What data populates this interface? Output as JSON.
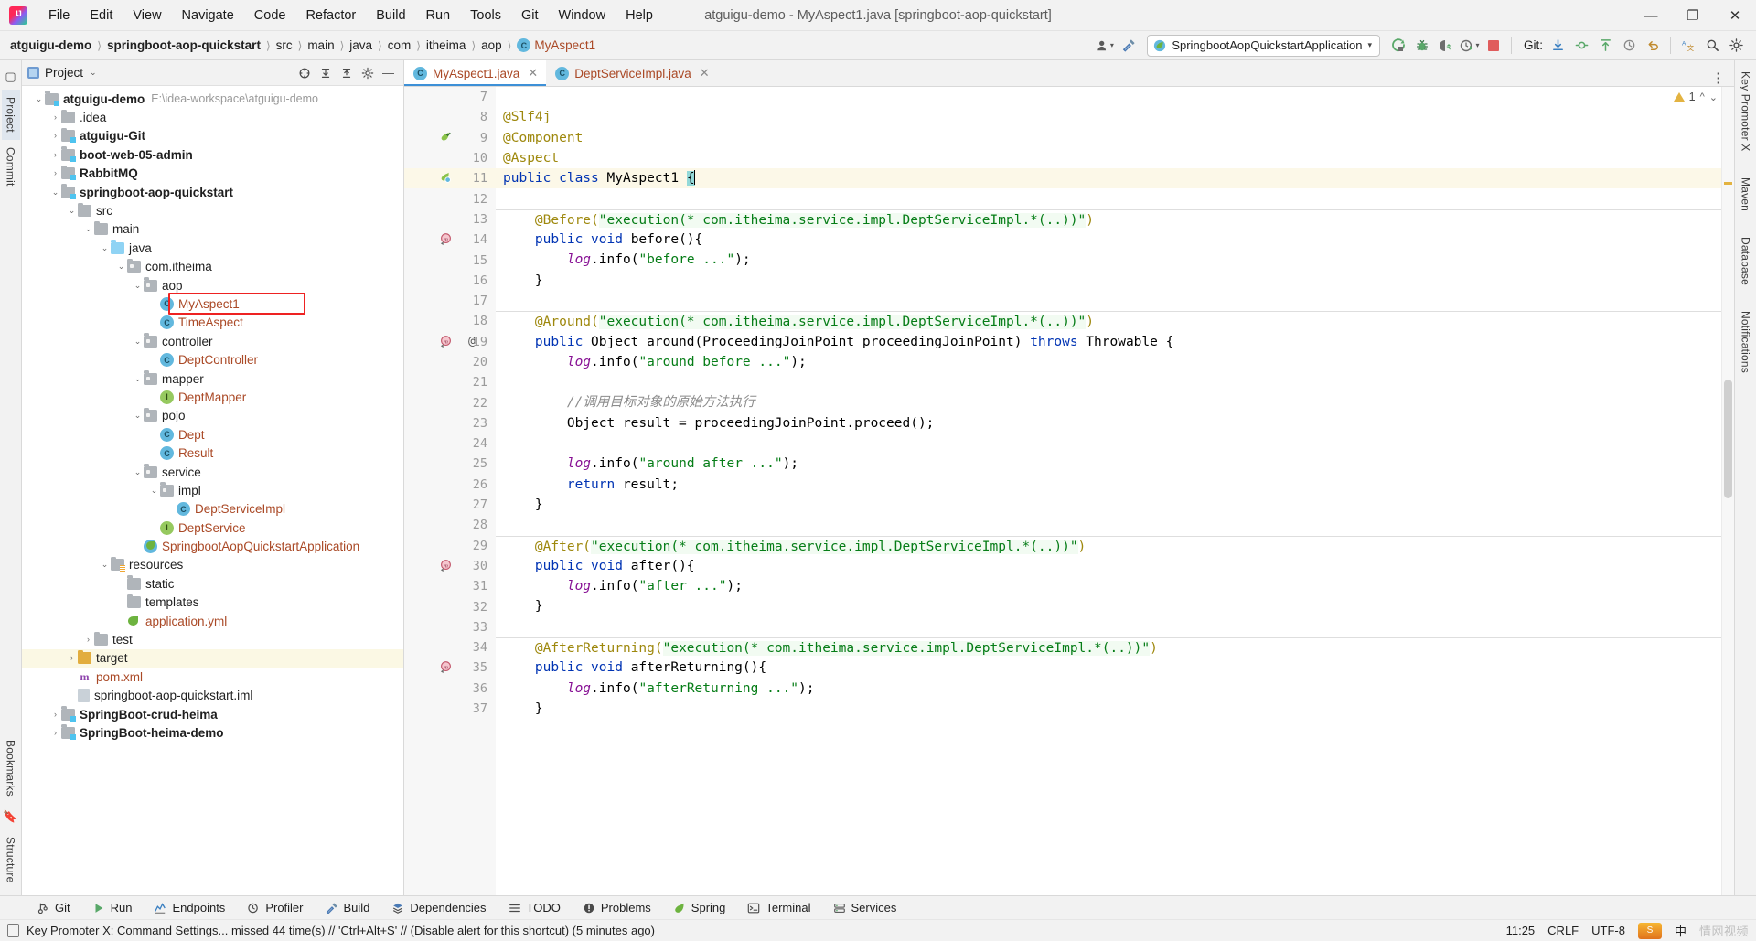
{
  "window": {
    "title": "atguigu-demo - MyAspect1.java [springboot-aop-quickstart]",
    "minimize": "—",
    "maximize": "❐",
    "close": "✕"
  },
  "menubar": [
    {
      "label": "File"
    },
    {
      "label": "Edit"
    },
    {
      "label": "View"
    },
    {
      "label": "Navigate"
    },
    {
      "label": "Code"
    },
    {
      "label": "Refactor"
    },
    {
      "label": "Build"
    },
    {
      "label": "Run"
    },
    {
      "label": "Tools"
    },
    {
      "label": "Git"
    },
    {
      "label": "Window"
    },
    {
      "label": "Help"
    }
  ],
  "breadcrumbs": [
    {
      "label": "atguigu-demo",
      "bold": true
    },
    {
      "label": "springboot-aop-quickstart",
      "bold": true
    },
    {
      "label": "src"
    },
    {
      "label": "main"
    },
    {
      "label": "java"
    },
    {
      "label": "com"
    },
    {
      "label": "itheima"
    },
    {
      "label": "aop"
    },
    {
      "label": "MyAspect1",
      "icon": "class-icon"
    }
  ],
  "toolbar": {
    "run_config": "SpringbootAopQuickstartApplication",
    "run_config_icon": "spring-boot-icon",
    "dropdown_arrow": "▾",
    "user_icon": "person-icon",
    "hammer_icon": "build-hammer-icon",
    "run_icon": "run-icon",
    "debug_icon": "debug-bug-icon",
    "coverage_icon": "run-with-coverage-icon",
    "profile_icon": "profiler-icon",
    "stop_icon": "stop-icon",
    "git_label": "Git:",
    "git_update_icon": "git-update-icon",
    "git_commit_icon": "git-commit-icon",
    "git_push_icon": "git-push-icon",
    "git_history_icon": "git-history-icon",
    "undo_icon": "undo-icon",
    "translate_icon": "translate-icon",
    "search_icon": "search-icon",
    "settings_icon": "gear-icon",
    "more_icon": "more-vertical-icon"
  },
  "left_rail": {
    "tabs": [
      {
        "label": "Project",
        "active": true
      },
      {
        "label": "Commit"
      }
    ],
    "bottom": [
      {
        "label": "Bookmarks"
      },
      {
        "label": "Structure"
      }
    ]
  },
  "right_rail": {
    "tabs": [
      {
        "label": "Key Promoter X"
      },
      {
        "label": "Maven"
      },
      {
        "label": "Database"
      },
      {
        "label": "Notifications"
      }
    ]
  },
  "project_panel": {
    "title": "Project",
    "caret": "⌄",
    "actions": [
      "select-opened-file-icon",
      "expand-all-icon",
      "collapse-all-icon",
      "settings-icon",
      "hide-icon"
    ],
    "tree": [
      {
        "depth": 0,
        "arrow": "⌄",
        "icon": "f-mod",
        "label": "atguigu-demo",
        "bold": true,
        "path": "E:\\idea-workspace\\atguigu-demo"
      },
      {
        "depth": 1,
        "arrow": "›",
        "icon": "f-plain",
        "label": ".idea"
      },
      {
        "depth": 1,
        "arrow": "›",
        "icon": "f-mod",
        "label": "atguigu-Git",
        "bold": true
      },
      {
        "depth": 1,
        "arrow": "›",
        "icon": "f-mod",
        "label": "boot-web-05-admin",
        "bold": true
      },
      {
        "depth": 1,
        "arrow": "›",
        "icon": "f-mod",
        "label": "RabbitMQ",
        "bold": true
      },
      {
        "depth": 1,
        "arrow": "⌄",
        "icon": "f-mod",
        "label": "springboot-aop-quickstart",
        "bold": true
      },
      {
        "depth": 2,
        "arrow": "⌄",
        "icon": "f-plain",
        "label": "src"
      },
      {
        "depth": 3,
        "arrow": "⌄",
        "icon": "f-plain",
        "label": "main"
      },
      {
        "depth": 4,
        "arrow": "⌄",
        "icon": "f-blue",
        "label": "java"
      },
      {
        "depth": 5,
        "arrow": "⌄",
        "icon": "f-pkg",
        "label": "com.itheima"
      },
      {
        "depth": 6,
        "arrow": "⌄",
        "icon": "f-pkg",
        "label": "aop"
      },
      {
        "depth": 7,
        "arrow": "",
        "icon": "class",
        "label": "MyAspect1",
        "cls": true,
        "highlight": true
      },
      {
        "depth": 7,
        "arrow": "",
        "icon": "class",
        "label": "TimeAspect",
        "cls": true
      },
      {
        "depth": 6,
        "arrow": "⌄",
        "icon": "f-pkg",
        "label": "controller"
      },
      {
        "depth": 7,
        "arrow": "",
        "icon": "class",
        "label": "DeptController",
        "cls": true
      },
      {
        "depth": 6,
        "arrow": "⌄",
        "icon": "f-pkg",
        "label": "mapper"
      },
      {
        "depth": 7,
        "arrow": "",
        "icon": "iface",
        "label": "DeptMapper",
        "cls": true
      },
      {
        "depth": 6,
        "arrow": "⌄",
        "icon": "f-pkg",
        "label": "pojo"
      },
      {
        "depth": 7,
        "arrow": "",
        "icon": "class",
        "label": "Dept",
        "cls": true
      },
      {
        "depth": 7,
        "arrow": "",
        "icon": "class",
        "label": "Result",
        "cls": true
      },
      {
        "depth": 6,
        "arrow": "⌄",
        "icon": "f-pkg",
        "label": "service"
      },
      {
        "depth": 7,
        "arrow": "⌄",
        "icon": "f-pkg",
        "label": "impl"
      },
      {
        "depth": 8,
        "arrow": "",
        "icon": "class",
        "label": "DeptServiceImpl",
        "cls": true
      },
      {
        "depth": 7,
        "arrow": "",
        "icon": "iface",
        "label": "DeptService",
        "cls": true
      },
      {
        "depth": 6,
        "arrow": "",
        "icon": "spring",
        "label": "SpringbootAopQuickstartApplication",
        "cls": true
      },
      {
        "depth": 4,
        "arrow": "⌄",
        "icon": "f-res",
        "label": "resources"
      },
      {
        "depth": 5,
        "arrow": "",
        "icon": "f-plain",
        "label": "static"
      },
      {
        "depth": 5,
        "arrow": "",
        "icon": "f-plain",
        "label": "templates"
      },
      {
        "depth": 5,
        "arrow": "",
        "icon": "yml",
        "label": "application.yml",
        "cls": true
      },
      {
        "depth": 3,
        "arrow": "›",
        "icon": "f-plain",
        "label": "test"
      },
      {
        "depth": 2,
        "arrow": "›",
        "icon": "f-tgt",
        "label": "target",
        "rowsel": true
      },
      {
        "depth": 2,
        "arrow": "",
        "icon": "maven",
        "label": "pom.xml",
        "cls": true
      },
      {
        "depth": 2,
        "arrow": "",
        "icon": "iml",
        "label": "springboot-aop-quickstart.iml"
      },
      {
        "depth": 1,
        "arrow": "›",
        "icon": "f-mod",
        "label": "SpringBoot-crud-heima",
        "bold": true
      },
      {
        "depth": 1,
        "arrow": "›",
        "icon": "f-mod",
        "label": "SpringBoot-heima-demo",
        "bold": true
      }
    ]
  },
  "editor": {
    "tabs": [
      {
        "label": "MyAspect1.java",
        "icon": "class-icon",
        "active": true,
        "close": "✕"
      },
      {
        "label": "DeptServiceImpl.java",
        "icon": "class-icon",
        "active": false,
        "close": "✕"
      }
    ],
    "inspection": {
      "count": "1",
      "icon": "warning-triangle-icon",
      "chevron": "⌄",
      "collapse": "⌃"
    },
    "first_line_number": 7,
    "current_line": 11,
    "lines": [
      {
        "n": 7,
        "tokens": []
      },
      {
        "n": 8,
        "tokens": [
          {
            "t": "@Slf4j",
            "c": "a"
          }
        ],
        "fold": "minus-open"
      },
      {
        "n": 9,
        "tokens": [
          {
            "t": "@Component",
            "c": "a"
          }
        ],
        "gmark": "spring-bean-icon"
      },
      {
        "n": 10,
        "tokens": [
          {
            "t": "@Aspect",
            "c": "a"
          }
        ],
        "fold": "minus"
      },
      {
        "n": 11,
        "tokens": [
          {
            "t": "public ",
            "c": "k"
          },
          {
            "t": "class ",
            "c": "k"
          },
          {
            "t": "MyAspect1 ",
            "c": "pl"
          },
          {
            "t": "{",
            "c": "sel-brace"
          }
        ],
        "current": true,
        "gmark": "spring-aspect-icon"
      },
      {
        "n": 12,
        "tokens": []
      },
      {
        "n": 13,
        "tokens": [
          {
            "t": "    @Before(",
            "c": "a"
          },
          {
            "t": "\"execution(* com.itheima.service.impl.DeptServiceImpl.*(..))\"",
            "c": "s strhl"
          },
          {
            "t": ")",
            "c": "a"
          }
        ],
        "sep_above": true
      },
      {
        "n": 14,
        "tokens": [
          {
            "t": "    ",
            "c": "pl"
          },
          {
            "t": "public ",
            "c": "k"
          },
          {
            "t": "void ",
            "c": "k"
          },
          {
            "t": "before(){",
            "c": "pl"
          }
        ],
        "gmark": "method-advice-icon",
        "fold": "minus-open"
      },
      {
        "n": 15,
        "tokens": [
          {
            "t": "        ",
            "c": "pl"
          },
          {
            "t": "log",
            "c": "fld"
          },
          {
            "t": ".info(",
            "c": "pl"
          },
          {
            "t": "\"before ...\"",
            "c": "s"
          },
          {
            "t": ");",
            "c": "pl"
          }
        ]
      },
      {
        "n": 16,
        "tokens": [
          {
            "t": "    }",
            "c": "pl"
          }
        ],
        "fold": "minus"
      },
      {
        "n": 17,
        "tokens": []
      },
      {
        "n": 18,
        "tokens": [
          {
            "t": "    @Around(",
            "c": "a"
          },
          {
            "t": "\"execution(* com.itheima.service.impl.DeptServiceImpl.*(..))\"",
            "c": "s strhl"
          },
          {
            "t": ")",
            "c": "a"
          }
        ],
        "sep_above": true
      },
      {
        "n": 19,
        "tokens": [
          {
            "t": "    ",
            "c": "pl"
          },
          {
            "t": "public ",
            "c": "k"
          },
          {
            "t": "Object ",
            "c": "pl"
          },
          {
            "t": "around(",
            "c": "pl"
          },
          {
            "t": "ProceedingJoinPoint ",
            "c": "pl"
          },
          {
            "t": "proceedingJoinPoint) ",
            "c": "pl"
          },
          {
            "t": "throws ",
            "c": "k"
          },
          {
            "t": "Throwable {",
            "c": "pl"
          }
        ],
        "gmark": "method-advice-icon",
        "gmark2": "@",
        "fold": "minus-open"
      },
      {
        "n": 20,
        "tokens": [
          {
            "t": "        ",
            "c": "pl"
          },
          {
            "t": "log",
            "c": "fld"
          },
          {
            "t": ".info(",
            "c": "pl"
          },
          {
            "t": "\"around before ...\"",
            "c": "s"
          },
          {
            "t": ");",
            "c": "pl"
          }
        ]
      },
      {
        "n": 21,
        "tokens": []
      },
      {
        "n": 22,
        "tokens": [
          {
            "t": "        //调用目标对象的原始方法执行",
            "c": "cm"
          }
        ]
      },
      {
        "n": 23,
        "tokens": [
          {
            "t": "        Object result = proceedingJoinPoint.proceed();",
            "c": "pl"
          }
        ]
      },
      {
        "n": 24,
        "tokens": []
      },
      {
        "n": 25,
        "tokens": [
          {
            "t": "        ",
            "c": "pl"
          },
          {
            "t": "log",
            "c": "fld"
          },
          {
            "t": ".info(",
            "c": "pl"
          },
          {
            "t": "\"around after ...\"",
            "c": "s"
          },
          {
            "t": ");",
            "c": "pl"
          }
        ]
      },
      {
        "n": 26,
        "tokens": [
          {
            "t": "        ",
            "c": "pl"
          },
          {
            "t": "return ",
            "c": "k"
          },
          {
            "t": "result;",
            "c": "pl"
          }
        ]
      },
      {
        "n": 27,
        "tokens": [
          {
            "t": "    }",
            "c": "pl"
          }
        ],
        "fold": "minus"
      },
      {
        "n": 28,
        "tokens": []
      },
      {
        "n": 29,
        "tokens": [
          {
            "t": "    @After(",
            "c": "a"
          },
          {
            "t": "\"execution(* com.itheima.service.impl.DeptServiceImpl.*(..))\"",
            "c": "s strhl"
          },
          {
            "t": ")",
            "c": "a"
          }
        ],
        "sep_above": true
      },
      {
        "n": 30,
        "tokens": [
          {
            "t": "    ",
            "c": "pl"
          },
          {
            "t": "public ",
            "c": "k"
          },
          {
            "t": "void ",
            "c": "k"
          },
          {
            "t": "after(){",
            "c": "pl"
          }
        ],
        "gmark": "method-advice-icon",
        "fold": "minus-open"
      },
      {
        "n": 31,
        "tokens": [
          {
            "t": "        ",
            "c": "pl"
          },
          {
            "t": "log",
            "c": "fld"
          },
          {
            "t": ".info(",
            "c": "pl"
          },
          {
            "t": "\"after ...\"",
            "c": "s"
          },
          {
            "t": ");",
            "c": "pl"
          }
        ]
      },
      {
        "n": 32,
        "tokens": [
          {
            "t": "    }",
            "c": "pl"
          }
        ],
        "fold": "minus"
      },
      {
        "n": 33,
        "tokens": []
      },
      {
        "n": 34,
        "tokens": [
          {
            "t": "    @AfterReturning(",
            "c": "a"
          },
          {
            "t": "\"execution(* com.itheima.service.impl.DeptServiceImpl.*(..))\"",
            "c": "s strhl"
          },
          {
            "t": ")",
            "c": "a"
          }
        ],
        "sep_above": true
      },
      {
        "n": 35,
        "tokens": [
          {
            "t": "    ",
            "c": "pl"
          },
          {
            "t": "public ",
            "c": "k"
          },
          {
            "t": "void ",
            "c": "k"
          },
          {
            "t": "afterReturning(){",
            "c": "pl"
          }
        ],
        "gmark": "method-advice-icon",
        "fold": "minus-open"
      },
      {
        "n": 36,
        "tokens": [
          {
            "t": "        ",
            "c": "pl"
          },
          {
            "t": "log",
            "c": "fld"
          },
          {
            "t": ".info(",
            "c": "pl"
          },
          {
            "t": "\"afterReturning ...\"",
            "c": "s"
          },
          {
            "t": ");",
            "c": "pl"
          }
        ]
      },
      {
        "n": 37,
        "tokens": [
          {
            "t": "    }",
            "c": "pl"
          }
        ],
        "fold": "minus"
      }
    ]
  },
  "tool_windows": [
    {
      "label": "Git",
      "icon": "git-branch-icon"
    },
    {
      "label": "Run",
      "icon": "run-icon"
    },
    {
      "label": "Endpoints",
      "icon": "endpoints-icon"
    },
    {
      "label": "Profiler",
      "icon": "profiler-icon"
    },
    {
      "label": "Build",
      "icon": "build-hammer-icon"
    },
    {
      "label": "Dependencies",
      "icon": "dependencies-icon"
    },
    {
      "label": "TODO",
      "icon": "todo-list-icon"
    },
    {
      "label": "Problems",
      "icon": "problems-icon"
    },
    {
      "label": "Spring",
      "icon": "spring-leaf-icon"
    },
    {
      "label": "Terminal",
      "icon": "terminal-icon"
    },
    {
      "label": "Services",
      "icon": "services-icon"
    }
  ],
  "statusbar": {
    "icon": "key-promoter-icon",
    "message": "Key Promoter X: Command Settings... missed 44 time(s) // 'Ctrl+Alt+S' // (Disable alert for this shortcut) (5 minutes ago)",
    "time": "11:25",
    "line_sep": "CRLF",
    "encoding": "UTF-8",
    "ime_label": "中",
    "watermark": "情网视频",
    "ime_icon": "sogou-ime-icon"
  },
  "colors": {
    "accent": "#3d90d7",
    "highlight_box": "#ee2222",
    "class_text": "#aa4926",
    "keyword": "#0033b3",
    "string": "#067d17",
    "annotation": "#9e880d",
    "comment": "#8c8c8c",
    "field": "#871094",
    "current_line": "#fcf8e8"
  }
}
